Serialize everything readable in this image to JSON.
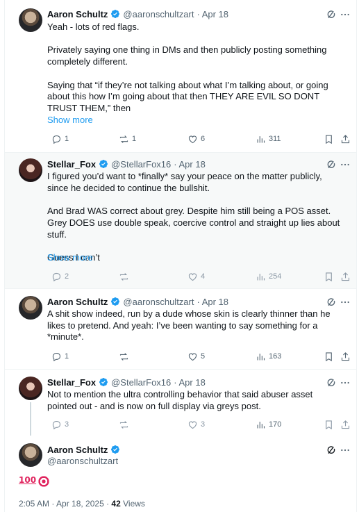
{
  "replies": [
    {
      "name": "Aaron Schultz",
      "handle": "@aaronschultzart",
      "time": "· Apr 18",
      "text": "Yeah - lots of red flags.\n\nPrivately saying one thing in DMs and then publicly posting something completely different.\n\nSaying that “if they’re not talking about what I’m talking about, or going about this how I’m going about that then THEY ARE EVIL SO DONT TRUST THEM,” then",
      "show_more": "Show more",
      "stats": {
        "replies": "1",
        "reposts": "1",
        "likes": "6",
        "views": "311"
      }
    },
    {
      "name": "Stellar_Fox",
      "handle": "@StellarFox16",
      "time": "· Apr 18",
      "text": "I figured you’d want to *finally* say your peace on the matter publicly, since he decided to continue the bullshit.\n\nAnd Brad WAS correct about grey. Despite him still being a POS asset. Grey DOES use double speak, coercive control and straight up lies about stuff.\n\nGuess I can’t",
      "show_more": "Show more",
      "stats": {
        "replies": "2",
        "reposts": "",
        "likes": "4",
        "views": "254"
      }
    },
    {
      "name": "Aaron Schultz",
      "handle": "@aaronschultzart",
      "time": "· Apr 18",
      "text": "A shit show indeed, run by a dude whose skin is clearly thinner than he likes to pretend. And yeah: I’ve been wanting to say something for a *minute*.",
      "stats": {
        "replies": "1",
        "reposts": "",
        "likes": "5",
        "views": "163"
      }
    },
    {
      "name": "Stellar_Fox",
      "handle": "@StellarFox16",
      "time": "· Apr 18",
      "text": "Not to mention the ultra controlling behavior that said abuser asset pointed out - and is now on full display via greys post.",
      "stats": {
        "replies": "3",
        "reposts": "",
        "likes": "3",
        "views": "170"
      }
    }
  ],
  "main": {
    "name": "Aaron Schultz",
    "handle": "@aaronschultzart",
    "emoji_100": "100",
    "timestamp": "2:05 AM · Apr 18, 2025 · ",
    "views_count": "42",
    "views_label": " Views"
  },
  "colors": {
    "verified": "#1d9bf0",
    "link": "#1d9bf0",
    "muted": "#536471"
  }
}
